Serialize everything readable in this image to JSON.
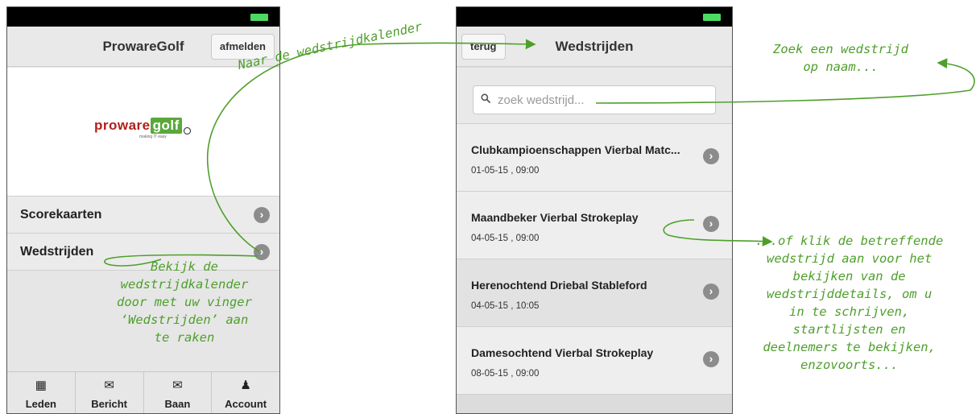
{
  "phone_home": {
    "header": {
      "title": "ProwareGolf",
      "logout_label": "afmelden"
    },
    "logo": {
      "brand_left": "proware",
      "brand_right": "golf",
      "tagline": "making IT easy"
    },
    "menu": [
      {
        "label": "Scorekaarten"
      },
      {
        "label": "Wedstrijden"
      }
    ],
    "tabs": [
      {
        "icon": "document-icon",
        "label": "Leden"
      },
      {
        "icon": "envelope-icon",
        "label": "Bericht"
      },
      {
        "icon": "envelope-icon",
        "label": "Baan"
      },
      {
        "icon": "user-icon",
        "label": "Account"
      }
    ]
  },
  "phone_matches": {
    "header": {
      "title": "Wedstrijden",
      "back_label": "terug"
    },
    "search": {
      "placeholder": "zoek wedstrijd..."
    },
    "matches": [
      {
        "title": "Clubkampioenschappen Vierbal Matc...",
        "datetime": "01-05-15 , 09:00"
      },
      {
        "title": "Maandbeker Vierbal Strokeplay",
        "datetime": "04-05-15 , 09:00"
      },
      {
        "title": "Herenochtend Driebal Stableford",
        "datetime": "04-05-15 , 10:05"
      },
      {
        "title": "Damesochtend Vierbal Strokeplay",
        "datetime": "08-05-15 , 09:00"
      }
    ]
  },
  "annotations": {
    "calendar_link": "Naar de wedstrijdkalender",
    "tap_hint": "Bekijk de\nwedstrijdkalender\ndoor met uw vinger\n‘Wedstrijden’ aan\nte raken",
    "search_hint": "Zoek een wedstrijd\nop naam...",
    "click_hint": "...of klik de betreffende\nwedstrijd aan voor het\nbekijken van de\nwedstrijddetails, om u\nin te schrijven,\nstartlijsten en\ndeelnemers te bekijken,\nenzovoorts..."
  },
  "colors": {
    "annotation": "#4e9f2b",
    "brand_red": "#b0201c",
    "brand_green": "#5aa83a",
    "battery": "#4cd964"
  }
}
